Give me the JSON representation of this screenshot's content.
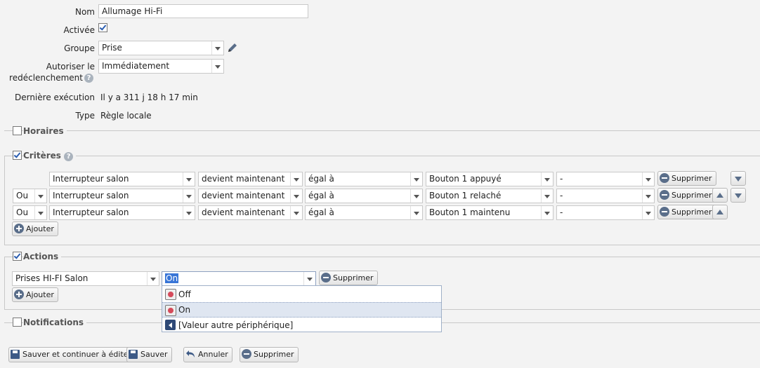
{
  "form": {
    "nom_label": "Nom",
    "nom_value": "Allumage Hi-Fi",
    "activee_label": "Activée",
    "activee_checked": true,
    "groupe_label": "Groupe",
    "groupe_value": "Prise",
    "autoriser_label_1": "Autoriser le",
    "autoriser_label_2": "redéclenchement",
    "autoriser_value": "Immédiatement",
    "derniere_label": "Dernière exécution",
    "derniere_value": "Il y a 311 j 18 h 17 min",
    "type_label": "Type",
    "type_value": "Règle locale"
  },
  "sections": {
    "horaires": {
      "label": "Horaires",
      "checked": false
    },
    "criteres": {
      "label": "Critères",
      "checked": true
    },
    "actions": {
      "label": "Actions",
      "checked": true
    },
    "notifications": {
      "label": "Notifications",
      "checked": false
    }
  },
  "criteria": [
    {
      "op": "",
      "device": "Interrupteur salon",
      "event": "devient maintenant",
      "cmp": "égal à",
      "value": "Bouton 1 appuyé",
      "extra": "-",
      "delete": "Supprimer"
    },
    {
      "op": "Ou",
      "device": "Interrupteur salon",
      "event": "devient maintenant",
      "cmp": "égal à",
      "value": "Bouton 1 relaché",
      "extra": "-",
      "delete": "Supprimer"
    },
    {
      "op": "Ou",
      "device": "Interrupteur salon",
      "event": "devient maintenant",
      "cmp": "égal à",
      "value": "Bouton 1 maintenu",
      "extra": "-",
      "delete": "Supprimer"
    }
  ],
  "add_label": "Ajouter",
  "actions": {
    "device": "Prises HI-FI Salon",
    "value": "On",
    "delete": "Supprimer",
    "dropdown": [
      "Off",
      "On",
      "[Valeur autre périphérique]"
    ]
  },
  "footer": {
    "save_continue": "Sauver et continuer à éditer",
    "save": "Sauver",
    "cancel": "Annuler",
    "delete": "Supprimer"
  },
  "help_glyph": "?"
}
